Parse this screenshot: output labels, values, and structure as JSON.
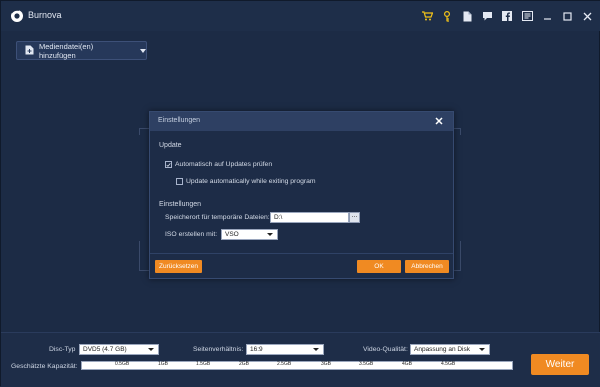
{
  "app": {
    "title": "Burnova"
  },
  "titlebar": {
    "icons": [
      "cart-icon",
      "key-icon",
      "document-icon",
      "feedback-icon",
      "facebook-icon",
      "menu-icon",
      "minimize-icon",
      "maximize-icon",
      "close-icon"
    ]
  },
  "toolbar": {
    "add_media_label": "Mediendatei(en) hinzufügen"
  },
  "dialog": {
    "title": "Einstellungen",
    "update_section": "Update",
    "auto_update_label": "Automatisch auf Updates prüfen",
    "auto_update_checked": true,
    "update_on_exit_label": "Update automatically while exiting program",
    "update_on_exit_checked": false,
    "settings_section": "Einstellungen",
    "temp_path_label": "Speicherort für temporäre Dateien:",
    "temp_path_value": "D:\\",
    "browse_label": "...",
    "iso_label": "ISO erstellen mit:",
    "iso_value": "VSO",
    "reset_label": "Zurücksetzen",
    "ok_label": "OK",
    "cancel_label": "Abbrechen"
  },
  "bottom": {
    "disc_type_label": "Disc-Typ",
    "disc_type_value": "DVD5 (4.7 GB)",
    "aspect_label": "Seitenverhältnis:",
    "aspect_value": "16:9",
    "quality_label": "Video-Qualität:",
    "quality_value": "Anpassung an Disk",
    "capacity_label": "Geschätzte Kapazität:",
    "capacity_ticks": [
      "0.5GB",
      "1GB",
      "1.5GB",
      "2GB",
      "2.5GB",
      "3GB",
      "3.5GB",
      "4GB",
      "4.5GB"
    ],
    "next_label": "Weiter"
  },
  "colors": {
    "accent": "#f08a22",
    "background": "#1c2b45"
  }
}
